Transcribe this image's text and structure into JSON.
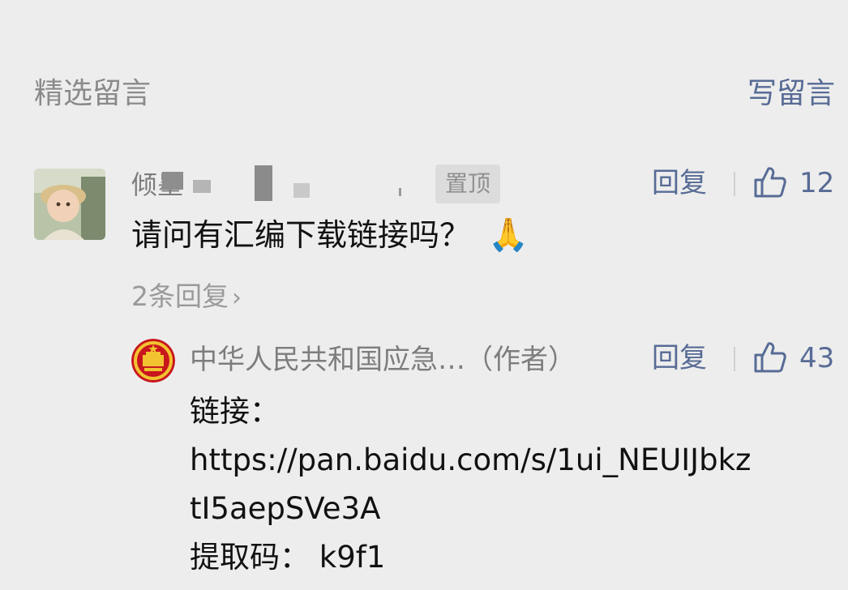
{
  "header": {
    "title": "精选留言",
    "write_comment": "写留言"
  },
  "comments": [
    {
      "username": "倾墨",
      "pinned_label": "置顶",
      "reply_label": "回复",
      "likes": "12",
      "text": "请问有汇编下载链接吗？",
      "emoji": "🙏",
      "reply_count_label": "2条回复",
      "replies": [
        {
          "author": "中华人民共和国应急…（作者）",
          "reply_label": "回复",
          "likes": "43",
          "lines": [
            "链接：",
            "https://pan.baidu.com/s/1ui_NEUIJbkz",
            "tI5aepSVe3A",
            "提取码： k9f1"
          ]
        }
      ]
    }
  ],
  "colors": {
    "link": "#576b95",
    "muted": "#8a8a8a",
    "background": "#ededed",
    "text": "#111111"
  },
  "icons": [
    "thumbs-up-icon",
    "chevron-right-icon",
    "national-emblem-icon",
    "user-avatar"
  ]
}
